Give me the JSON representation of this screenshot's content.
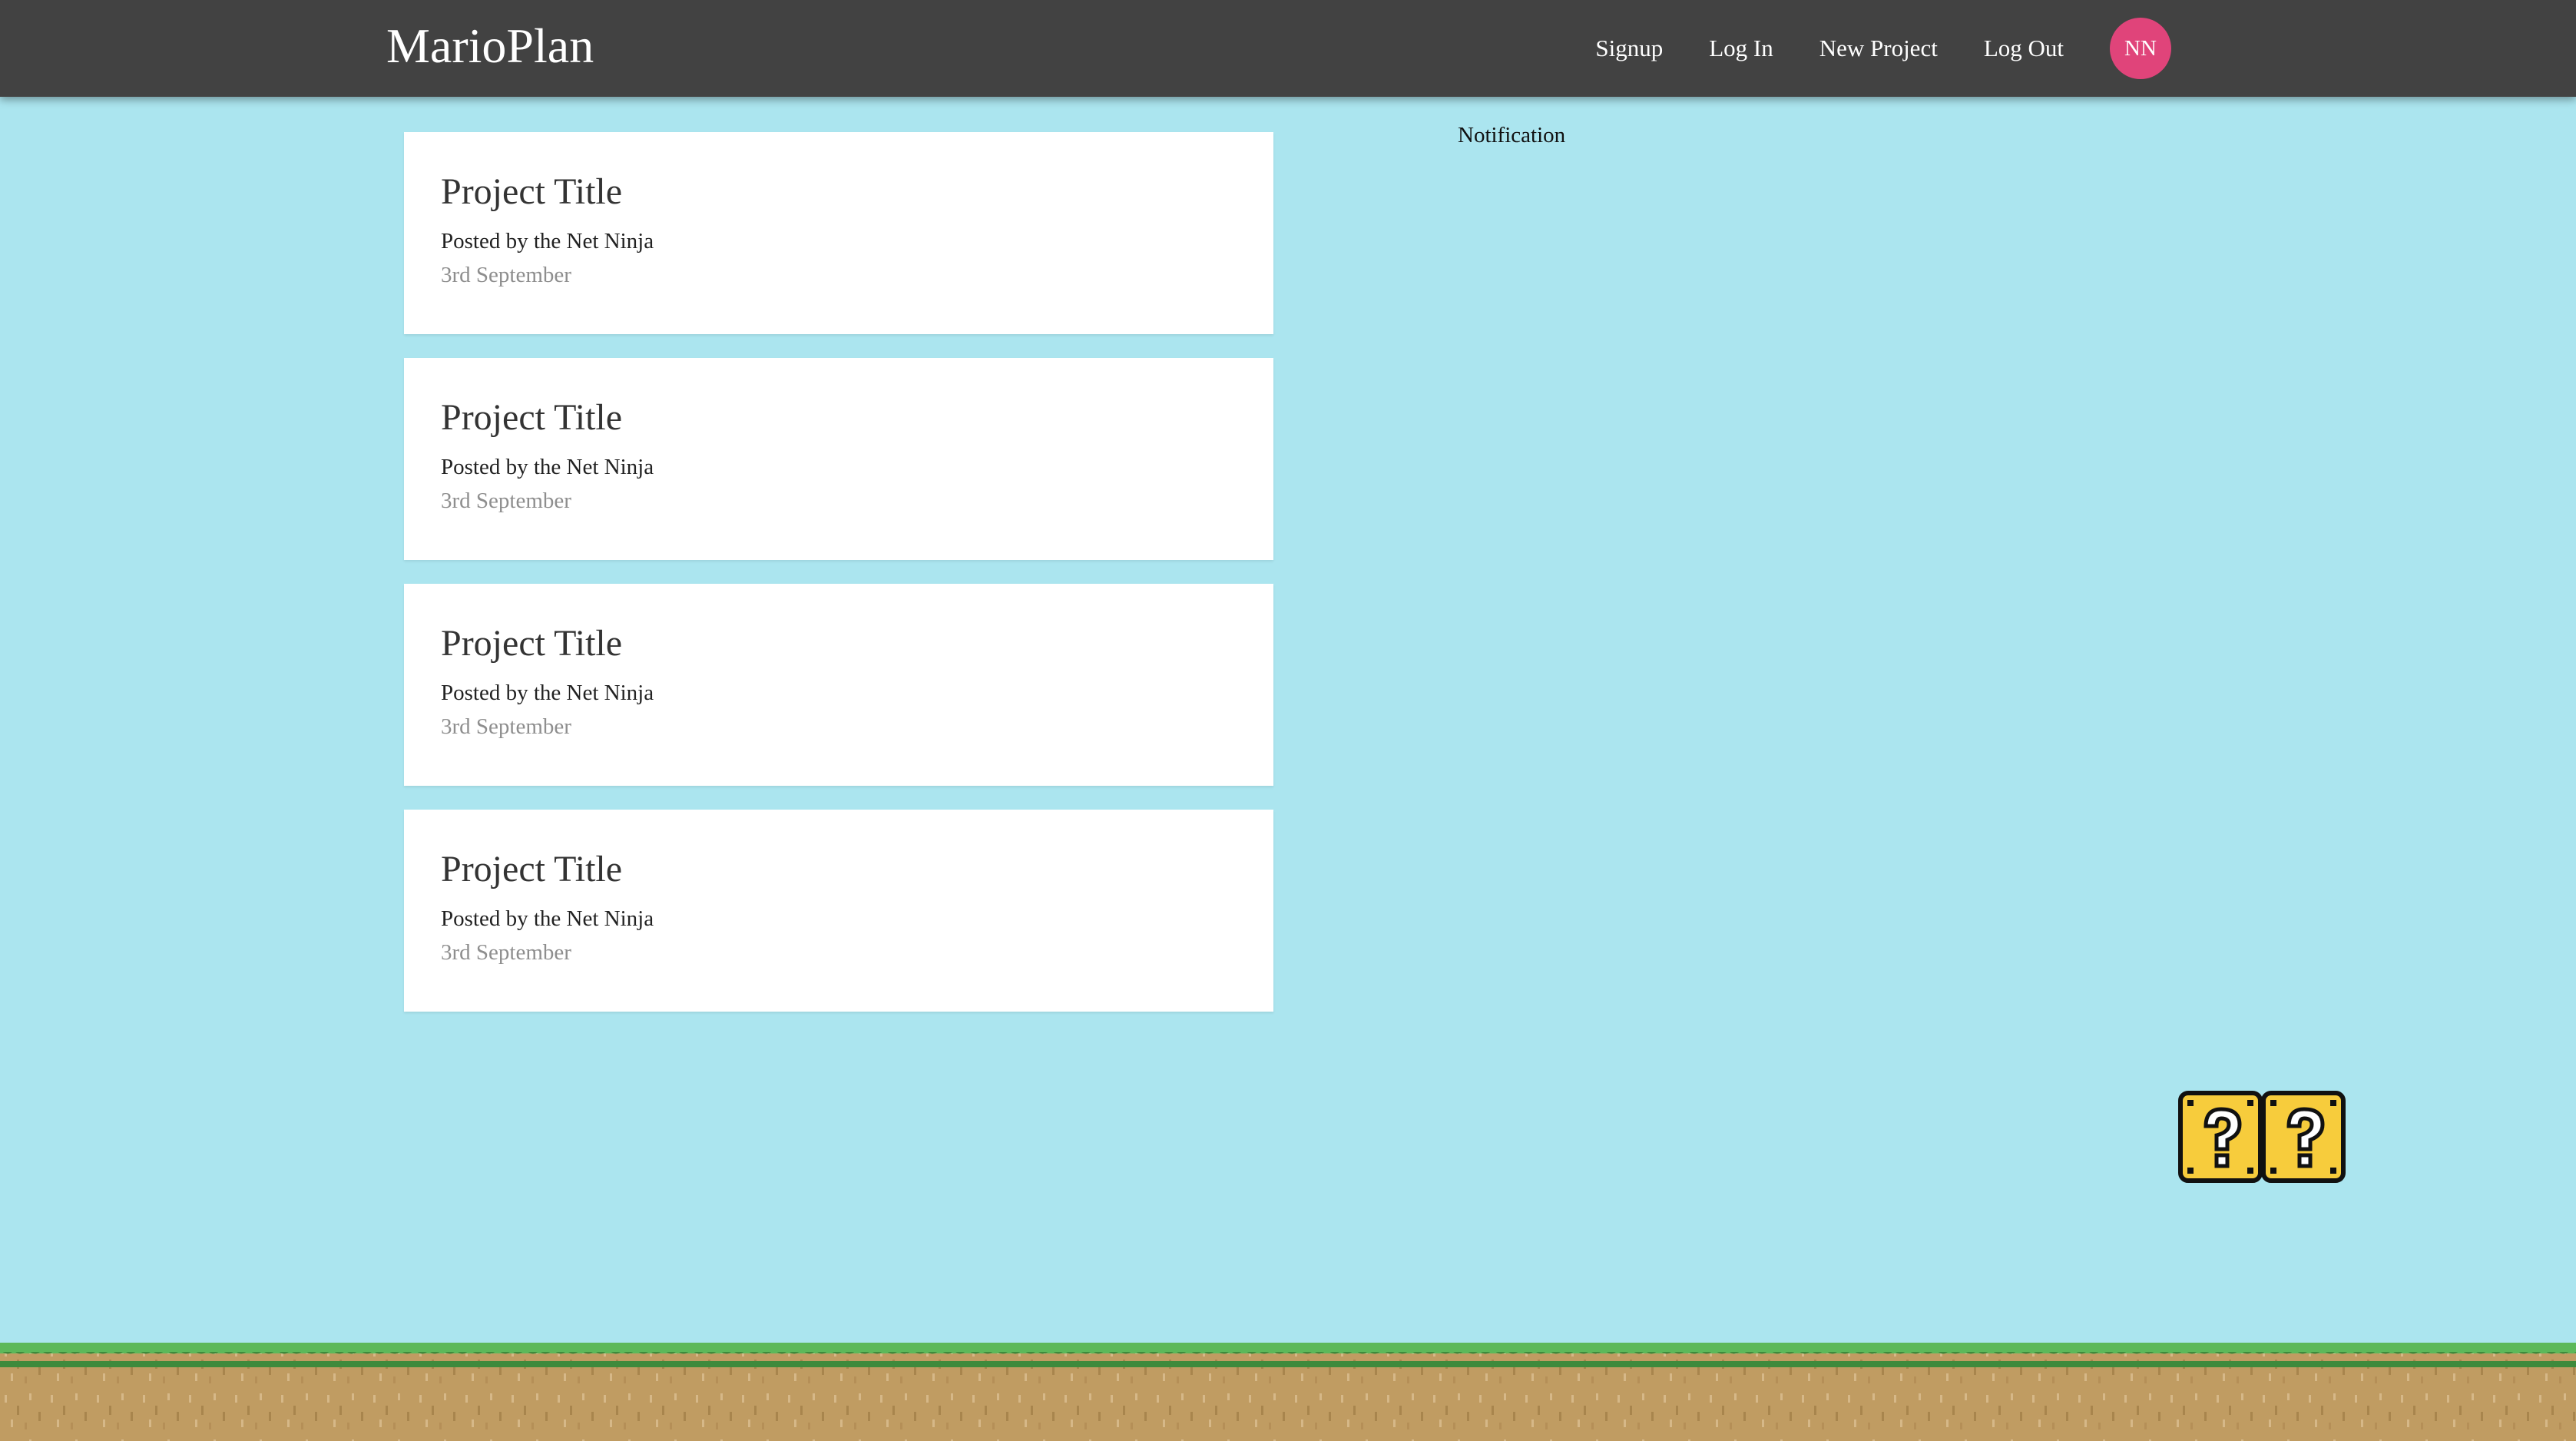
{
  "navbar": {
    "brand": "MarioPlan",
    "links": {
      "signup": "Signup",
      "login": "Log In",
      "new_project": "New Project",
      "logout": "Log Out"
    },
    "avatar_initials": "NN",
    "avatar_color": "#e0447a",
    "background_color": "#424242"
  },
  "projects": [
    {
      "title": "Project Title",
      "author": "Posted by the Net Ninja",
      "date": "3rd September"
    },
    {
      "title": "Project Title",
      "author": "Posted by the Net Ninja",
      "date": "3rd September"
    },
    {
      "title": "Project Title",
      "author": "Posted by the Net Ninja",
      "date": "3rd September"
    },
    {
      "title": "Project Title",
      "author": "Posted by the Net Ninja",
      "date": "3rd September"
    }
  ],
  "notifications": {
    "label": "Notification"
  },
  "decor": {
    "question_block_icon": "question-block-icon",
    "ground_icon": "grass-ground-icon"
  },
  "colors": {
    "sky": "#abe5ef",
    "grass": "#4caf50",
    "dirt": "#c0a060"
  }
}
